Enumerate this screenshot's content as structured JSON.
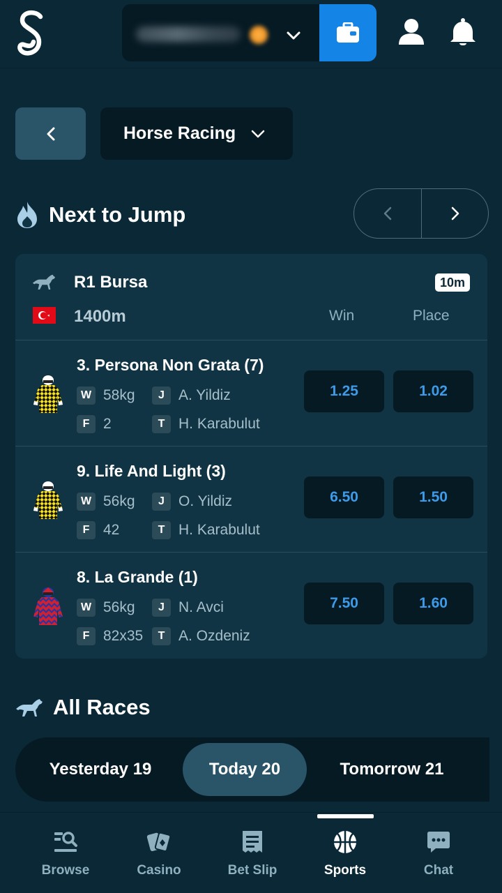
{
  "header": {
    "logo": "S",
    "balance_icon": "coin-icon",
    "wallet_icon": "wallet-icon",
    "profile_icon": "profile-icon",
    "notifications_icon": "bell-icon"
  },
  "sport_selector": {
    "back_icon": "chevron-left-icon",
    "label": "Horse Racing"
  },
  "next_to_jump": {
    "title": "Next to Jump",
    "race": {
      "name": "R1 Bursa",
      "time_to_jump": "10m",
      "distance": "1400m",
      "country_flag": "turkey-flag",
      "col_win": "Win",
      "col_place": "Place"
    },
    "runners": [
      {
        "name": "3. Persona Non Grata (7)",
        "w_tag": "W",
        "weight": "58kg",
        "j_tag": "J",
        "jockey": "A. Yildiz",
        "f_tag": "F",
        "form": "2",
        "t_tag": "T",
        "trainer": "H. Karabulut",
        "win": "1.25",
        "place": "1.02",
        "silk": "yellow-black-diamonds"
      },
      {
        "name": "9. Life And Light (3)",
        "w_tag": "W",
        "weight": "56kg",
        "j_tag": "J",
        "jockey": "O. Yildiz",
        "f_tag": "F",
        "form": "42",
        "t_tag": "T",
        "trainer": "H. Karabulut",
        "win": "6.50",
        "place": "1.50",
        "silk": "yellow-black-diamonds"
      },
      {
        "name": "8. La Grande (1)",
        "w_tag": "W",
        "weight": "56kg",
        "j_tag": "J",
        "jockey": "N. Avci",
        "f_tag": "F",
        "form": "82x35",
        "t_tag": "T",
        "trainer": "A. Ozdeniz",
        "win": "7.50",
        "place": "1.60",
        "silk": "red-blue-chevrons"
      }
    ]
  },
  "all_races": {
    "title": "All Races",
    "days": [
      {
        "label": "Yesterday 19",
        "selected": false
      },
      {
        "label": "Today 20",
        "selected": true
      },
      {
        "label": "Tomorrow 21",
        "selected": false
      }
    ]
  },
  "bottom_nav": [
    {
      "label": "Browse",
      "icon": "browse-icon",
      "active": false
    },
    {
      "label": "Casino",
      "icon": "casino-icon",
      "active": false
    },
    {
      "label": "Bet Slip",
      "icon": "bet-slip-icon",
      "active": false
    },
    {
      "label": "Sports",
      "icon": "sports-icon",
      "active": true
    },
    {
      "label": "Chat",
      "icon": "chat-icon",
      "active": false
    }
  ],
  "colors": {
    "background": "#0b2836",
    "card": "#103444",
    "accent": "#1484e6",
    "odds_text": "#3d9be9"
  }
}
